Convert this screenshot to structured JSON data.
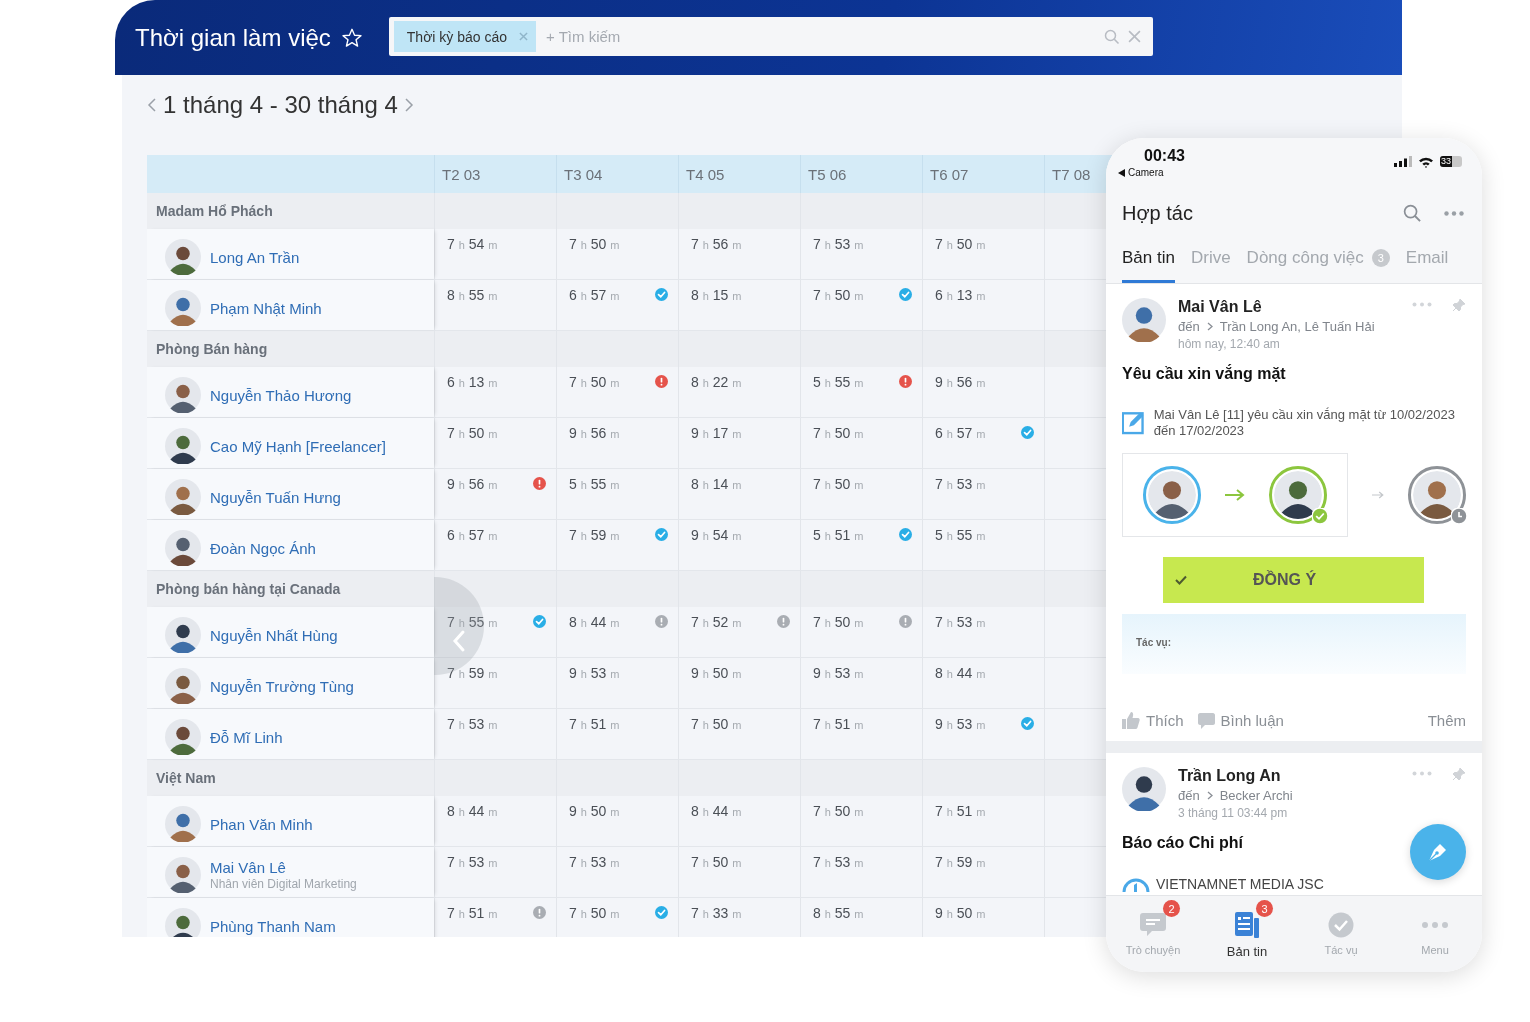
{
  "header": {
    "title": "Thời gian làm việc",
    "search": {
      "chip": "Thời kỳ báo cáo",
      "placeholder": "+ Tìm kiếm"
    }
  },
  "period": {
    "label": "1 tháng 4 - 30 tháng 4"
  },
  "table": {
    "columns": [
      "T2 03",
      "T3 04",
      "T4 05",
      "T5 06",
      "T6 07",
      "T7 08"
    ],
    "groups": [
      {
        "name": "Madam Hổ Phách",
        "people": [
          {
            "name": "Long An Trần",
            "cells": [
              {
                "time": "7 h 54 m"
              },
              {
                "time": "7 h 50 m"
              },
              {
                "time": "7 h 56 m"
              },
              {
                "time": "7 h 53 m"
              },
              {
                "time": "7 h 50 m"
              }
            ]
          },
          {
            "name": "Phạm Nhật Minh",
            "cells": [
              {
                "time": "8 h 55 m"
              },
              {
                "time": "6 h 57 m",
                "kind": "approved"
              },
              {
                "time": "8 h 15 m"
              },
              {
                "time": "7 h 50 m",
                "kind": "approved"
              },
              {
                "time": "6 h 13 m"
              }
            ]
          }
        ]
      },
      {
        "name": "Phòng Bán hàng",
        "people": [
          {
            "name": "Nguyễn Thảo Hương",
            "cells": [
              {
                "time": "6 h 13 m"
              },
              {
                "time": "7 h 50 m",
                "kind": "warning"
              },
              {
                "time": "8 h 22 m"
              },
              {
                "time": "5 h 55 m",
                "kind": "warning"
              },
              {
                "time": "9 h 56 m"
              }
            ]
          },
          {
            "name": "Cao Mỹ Hạnh [Freelancer]",
            "cells": [
              {
                "time": "7 h 50 m"
              },
              {
                "time": "9 h 56 m"
              },
              {
                "time": "9 h 17 m"
              },
              {
                "time": "7 h 50 m"
              },
              {
                "time": "6 h 57 m",
                "kind": "approved"
              }
            ]
          },
          {
            "name": "Nguyễn Tuấn Hưng",
            "cells": [
              {
                "time": "9 h 56 m",
                "kind": "warning"
              },
              {
                "time": "5 h 55 m"
              },
              {
                "time": "8 h 14 m"
              },
              {
                "time": "7 h 50 m"
              },
              {
                "time": "7 h 53 m"
              }
            ]
          },
          {
            "name": "Đoàn Ngọc Ánh",
            "cells": [
              {
                "time": "6 h 57 m"
              },
              {
                "time": "7 h 59 m",
                "kind": "approved"
              },
              {
                "time": "9 h 54 m"
              },
              {
                "time": "5 h 51 m",
                "kind": "approved"
              },
              {
                "time": "5 h 55 m"
              }
            ]
          }
        ]
      },
      {
        "name": "Phòng bán hàng tại Canada",
        "people": [
          {
            "name": "Nguyễn Nhất Hùng",
            "cells": [
              {
                "time": "7 h 55 m",
                "kind": "approved"
              },
              {
                "time": "8 h 44 m",
                "kind": "note"
              },
              {
                "time": "7 h 52 m",
                "kind": "note"
              },
              {
                "time": "7 h 50 m",
                "kind": "note"
              },
              {
                "time": "7 h 53 m"
              }
            ]
          },
          {
            "name": "Nguyễn Trường Tùng",
            "cells": [
              {
                "time": "7 h 59 m"
              },
              {
                "time": "9 h 53 m"
              },
              {
                "time": "9 h 50 m"
              },
              {
                "time": "9 h 53 m"
              },
              {
                "time": "8 h 44 m"
              }
            ]
          },
          {
            "name": "Đỗ Mĩ Linh",
            "cells": [
              {
                "time": "7 h 53 m"
              },
              {
                "time": "7 h 51 m"
              },
              {
                "time": "7 h 50 m"
              },
              {
                "time": "7 h 51 m"
              },
              {
                "time": "9 h 53 m",
                "kind": "approved"
              }
            ]
          }
        ]
      },
      {
        "name": "Việt Nam",
        "people": [
          {
            "name": "Phan Văn Minh",
            "cells": [
              {
                "time": "8 h 44 m"
              },
              {
                "time": "9 h 50 m"
              },
              {
                "time": "8 h 44 m"
              },
              {
                "time": "7 h 50 m"
              },
              {
                "time": "7 h 51 m"
              }
            ]
          },
          {
            "name": "Mai Vân Lê",
            "role": "Nhân viên Digital Marketing",
            "cells": [
              {
                "time": "7 h 53 m"
              },
              {
                "time": "7 h 53 m"
              },
              {
                "time": "7 h 50 m"
              },
              {
                "time": "7 h 53 m"
              },
              {
                "time": "7 h 59 m"
              }
            ]
          },
          {
            "name": "Phùng Thanh Nam",
            "cells": [
              {
                "time": "7 h 51 m",
                "kind": "note"
              },
              {
                "time": "7 h 50 m",
                "kind": "approved"
              },
              {
                "time": "7 h 33 m"
              },
              {
                "time": "8 h 55 m"
              },
              {
                "time": "9 h 50 m"
              }
            ]
          }
        ]
      }
    ]
  },
  "phone": {
    "status_bar": {
      "time": "00:43",
      "back_label": "Camera",
      "battery": "33"
    },
    "title": "Hợp tác",
    "tabs": [
      {
        "label": "Bản tin",
        "selected": true
      },
      {
        "label": "Drive",
        "selected": false
      },
      {
        "label": "Dòng công việc",
        "badge": "3",
        "selected": false
      },
      {
        "label": "Email",
        "selected": false
      }
    ],
    "posts": [
      {
        "kind": "request",
        "author": "Mai Vân Lê",
        "to_label": "đến",
        "recipients": "Trần Long An, Lê Tuấn Hải",
        "time": "hôm nay, 12:40 am",
        "title": "Yêu cầu xin vắng mặt",
        "request": "Mai Vân Lê [11] yêu cầu xin vắng mặt từ 10/02/2023 đến 17/02/2023",
        "approvers": [
          {
            "kind": "current"
          },
          {
            "kind": "approved"
          },
          {
            "kind": "pending"
          }
        ],
        "approve_button": "ĐỒNG Ý",
        "task_label": "Tác vụ:",
        "actions": [
          "Thích",
          "Bình luận"
        ],
        "more": "Thêm"
      },
      {
        "kind": "report",
        "author": "Trần Long An",
        "to_label": "đến",
        "recipients": "Becker Archi",
        "time": "3 tháng 11 03:44 pm",
        "title": "Báo cáo Chi phí",
        "company": "VIETNAMNET MEDIA JSC"
      }
    ],
    "nav": [
      {
        "label": "Trò chuyện",
        "badge": "2",
        "selected": false
      },
      {
        "label": "Bản tin",
        "badge": "3",
        "selected": true
      },
      {
        "label": "Tác vụ",
        "selected": false
      },
      {
        "label": "Menu",
        "selected": false
      }
    ]
  }
}
